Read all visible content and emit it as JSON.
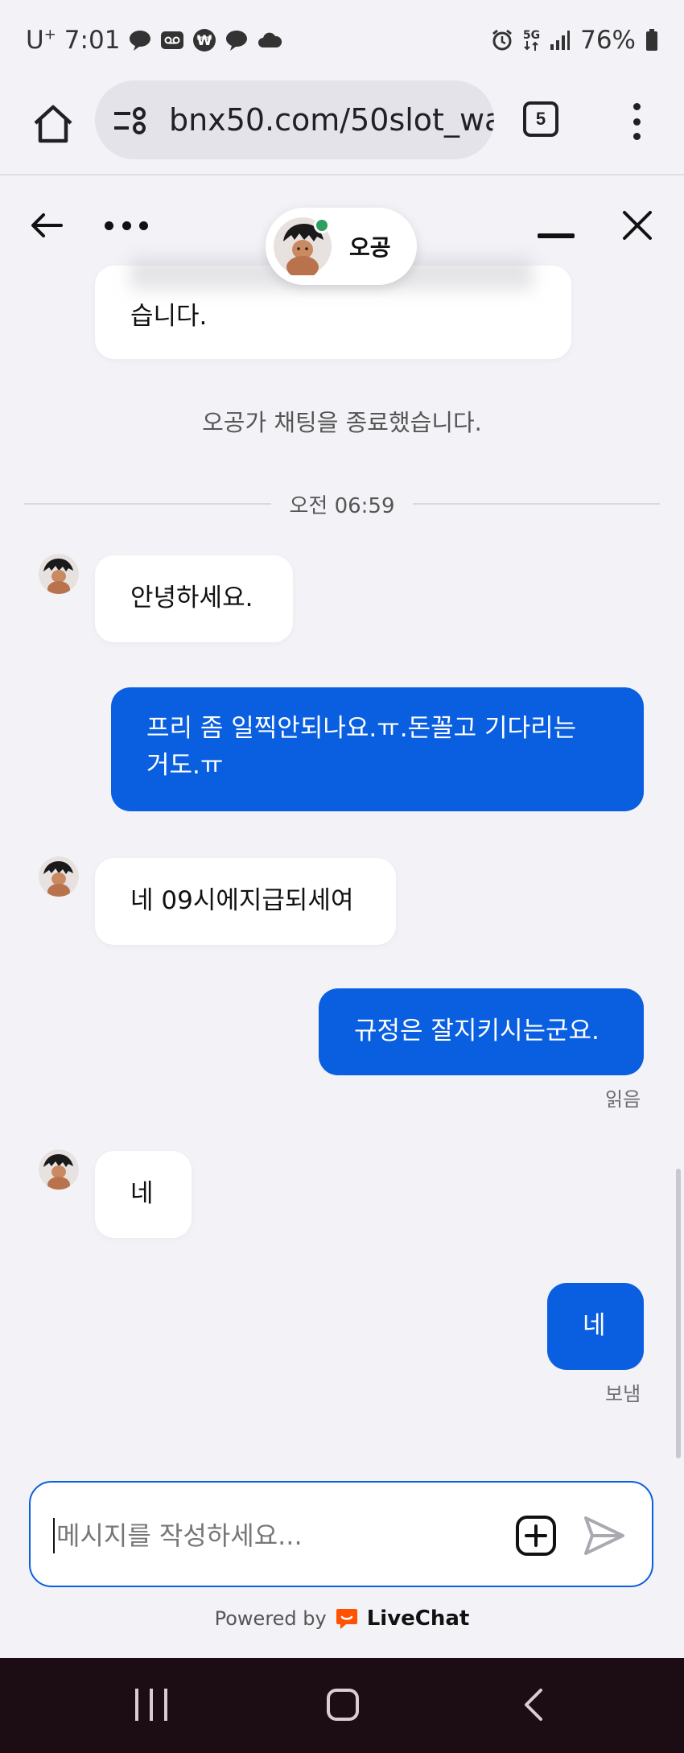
{
  "status_bar": {
    "carrier": "U",
    "carrier_sup": "+",
    "time": "7:01",
    "network": "5G",
    "battery": "76%"
  },
  "browser": {
    "url": "bnx50.com/50slot_wa",
    "tab_count": "5"
  },
  "chat_header": {
    "agent_name": "오공"
  },
  "messages": {
    "previous_tail": "습니다.",
    "system": "오공가 채팅을 종료했습니다.",
    "date_separator": "오전 06:59",
    "m1": "안녕하세요.",
    "m2_line1": "프리 좀 일찍안되나요.ㅠ.돈꼴고 기다리는",
    "m2_line2": "거도.ㅠ",
    "m3": "네 09시에지급되세여",
    "m4": "규정은 잘지키시는군요.",
    "m4_receipt": "읽음",
    "m5": "네",
    "m6": "네",
    "m6_receipt": "보냄"
  },
  "composer": {
    "placeholder": "메시지를 작성하세요...",
    "value": ""
  },
  "footer": {
    "powered_by": "Powered by",
    "brand": "LiveChat"
  },
  "colors": {
    "user_bubble": "#0a5fe0",
    "background": "#f3f2f7",
    "online": "#2d9e5e",
    "livechat_orange": "#ff5100"
  }
}
